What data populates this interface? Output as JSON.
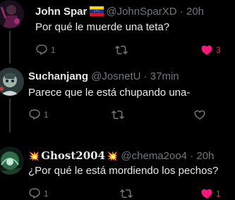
{
  "replies": [
    {
      "display_name": "John Spar",
      "flag_icon": "venezuela-flag-icon",
      "handle": "@JohnSparXD",
      "separator": "·",
      "time": "20h",
      "text": "Por qué le muerde una teta?",
      "reply_count": "1",
      "retweet_count": "",
      "like_count": "3",
      "liked": true
    },
    {
      "display_name": "Suchanjang",
      "handle": "@JosnetU",
      "separator": "·",
      "time": "37min",
      "text": "Parece que le está chupando una-",
      "reply_count": "1",
      "retweet_count": "",
      "like_count": "",
      "liked": false
    },
    {
      "display_name_prefix": "💥",
      "display_name": "Ghost2004",
      "display_name_suffix": "💥",
      "handle": "@chema2oo4",
      "separator": "·",
      "time": "20h",
      "text": "¿Por qué le está mordiendo los pechos?",
      "reply_count": "1",
      "retweet_count": "",
      "like_count": "1",
      "liked": true
    }
  ],
  "colors": {
    "background": "#000000",
    "primary_text": "#e7e9ea",
    "secondary_text": "#71767b",
    "like_pink": "#f91880",
    "divider": "#2f3336"
  }
}
